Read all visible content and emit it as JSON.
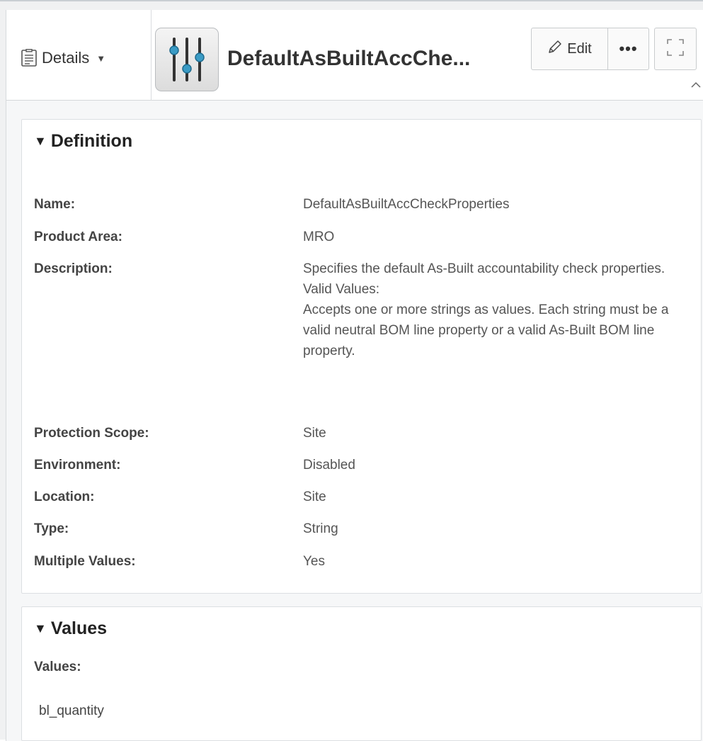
{
  "header": {
    "details_label": "Details",
    "object_title": "DefaultAsBuiltAccChe...",
    "edit_label": "Edit",
    "more_label": "•••"
  },
  "definition": {
    "section_title": "Definition",
    "properties": {
      "name": {
        "label": "Name:",
        "value": "DefaultAsBuiltAccCheckProperties"
      },
      "product_area": {
        "label": "Product Area:",
        "value": "MRO"
      },
      "description": {
        "label": "Description:",
        "line1": "Specifies the default As-Built accountability check properties.",
        "line2": "Valid Values:",
        "line3": "Accepts one or more strings as values. Each string must be a valid neutral BOM line property or a valid As-Built BOM line property."
      },
      "protection_scope": {
        "label": "Protection Scope:",
        "value": "Site"
      },
      "environment": {
        "label": "Environment:",
        "value": "Disabled"
      },
      "location": {
        "label": "Location:",
        "value": "Site"
      },
      "type": {
        "label": "Type:",
        "value": "String"
      },
      "multiple_values": {
        "label": "Multiple Values:",
        "value": "Yes"
      }
    }
  },
  "values": {
    "section_title": "Values",
    "label": "Values:",
    "items": [
      "bl_quantity"
    ]
  },
  "colors": {
    "accent": "#3a9bc5",
    "panel_bg": "#f6f7f8",
    "card_bg": "#ffffff"
  },
  "icons": {
    "details": "document-list-icon",
    "object": "sliders-preference-icon",
    "edit": "pencil-icon",
    "fullscreen": "fullscreen-icon",
    "collapse": "chevron-up-icon"
  }
}
